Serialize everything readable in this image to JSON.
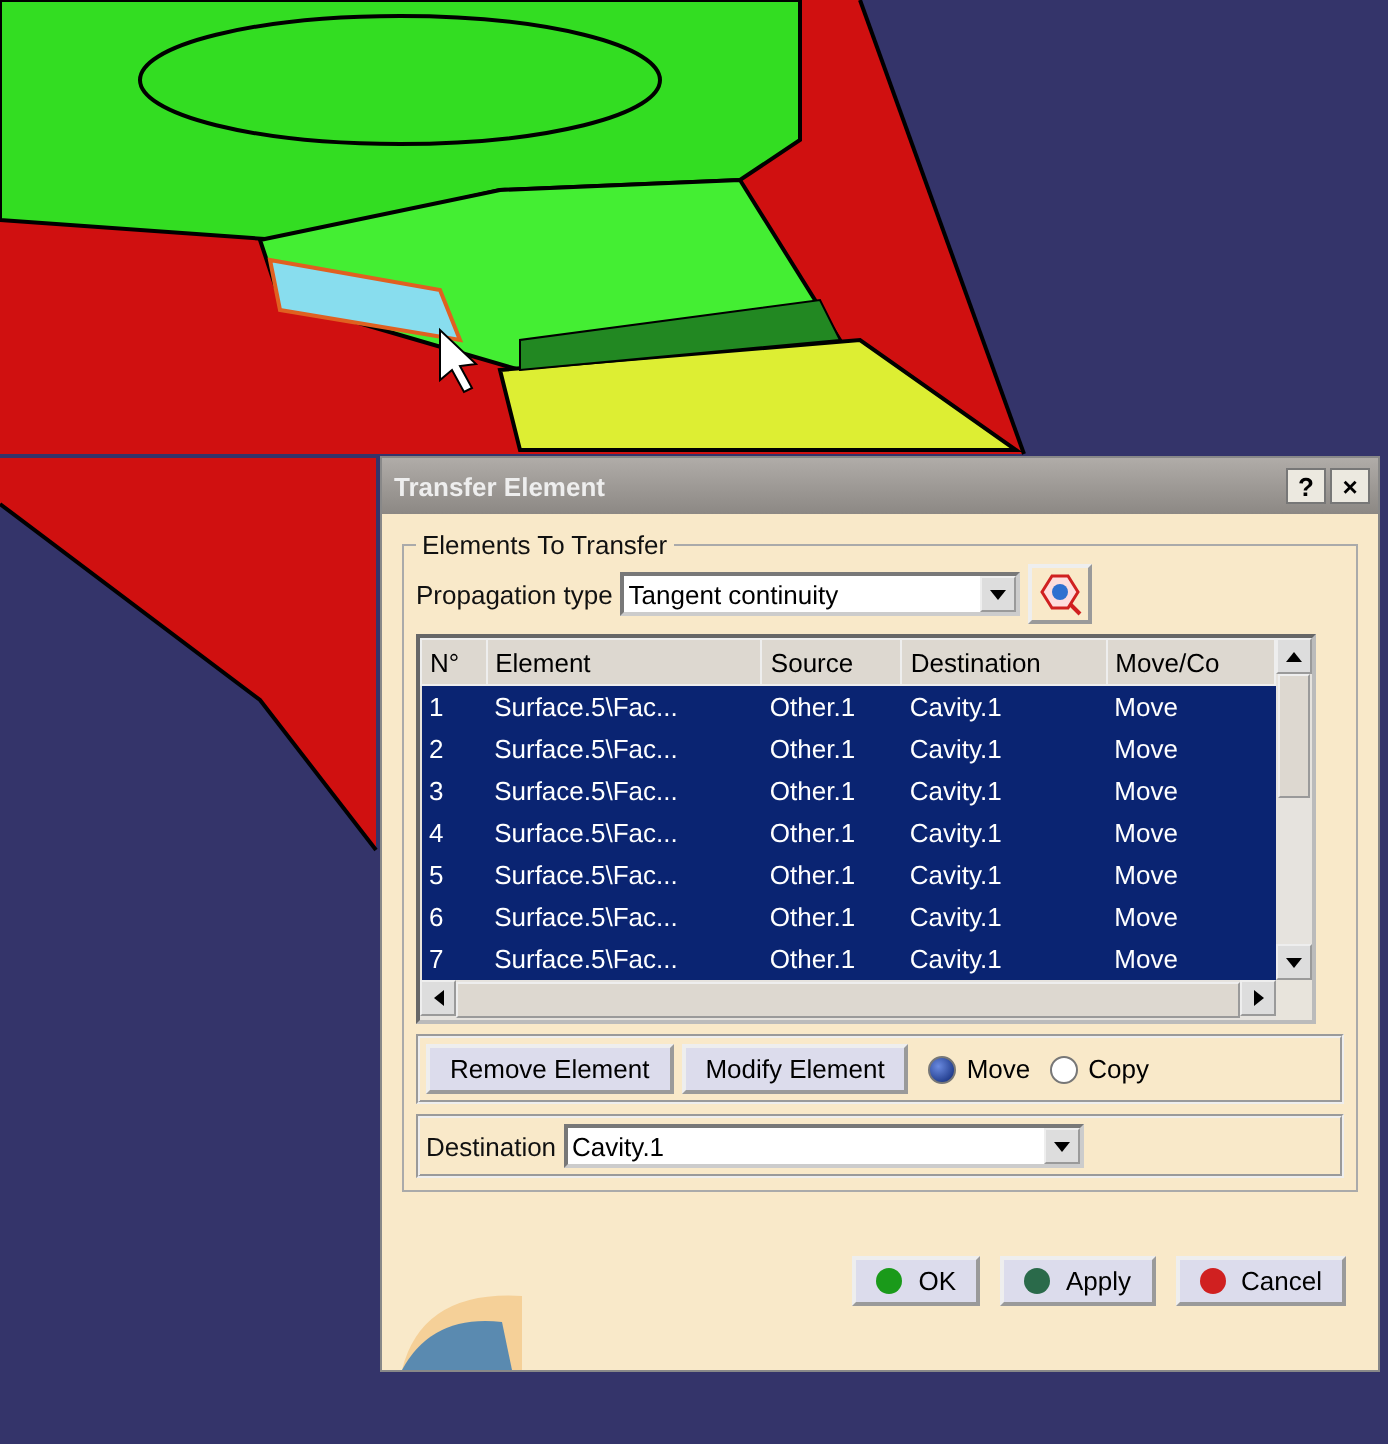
{
  "dialog": {
    "title": "Transfer Element",
    "title_buttons": [
      "?",
      "×"
    ],
    "group": {
      "legend": "Elements To Transfer",
      "propagation": {
        "label": "Propagation type",
        "value": "Tangent continuity"
      },
      "table": {
        "columns": [
          "N°",
          "Element",
          "Source",
          "Destination",
          "Move/Co"
        ],
        "rows": [
          {
            "cells": [
              "1",
              "Surface.5\\Fac...",
              "Other.1",
              "Cavity.1",
              "Move"
            ],
            "selected": true
          },
          {
            "cells": [
              "2",
              "Surface.5\\Fac...",
              "Other.1",
              "Cavity.1",
              "Move"
            ],
            "selected": true
          },
          {
            "cells": [
              "3",
              "Surface.5\\Fac...",
              "Other.1",
              "Cavity.1",
              "Move"
            ],
            "selected": true
          },
          {
            "cells": [
              "4",
              "Surface.5\\Fac...",
              "Other.1",
              "Cavity.1",
              "Move"
            ],
            "selected": true
          },
          {
            "cells": [
              "5",
              "Surface.5\\Fac...",
              "Other.1",
              "Cavity.1",
              "Move"
            ],
            "selected": true
          },
          {
            "cells": [
              "6",
              "Surface.5\\Fac...",
              "Other.1",
              "Cavity.1",
              "Move"
            ],
            "selected": true
          },
          {
            "cells": [
              "7",
              "Surface.5\\Fac...",
              "Other.1",
              "Cavity.1",
              "Move"
            ],
            "selected": true
          }
        ]
      },
      "actions": [
        "Remove Element",
        "Modify Element"
      ],
      "mode": [
        {
          "label": "Move",
          "selected": true
        },
        {
          "label": "Copy",
          "selected": false
        }
      ],
      "destination": {
        "label": "Destination",
        "value": "Cavity.1"
      }
    },
    "buttons": [
      {
        "label": "OK",
        "color": "#1a9a1a"
      },
      {
        "label": "Apply",
        "color": "#2a6a4a"
      },
      {
        "label": "Cancel",
        "color": "#d02020"
      }
    ]
  }
}
